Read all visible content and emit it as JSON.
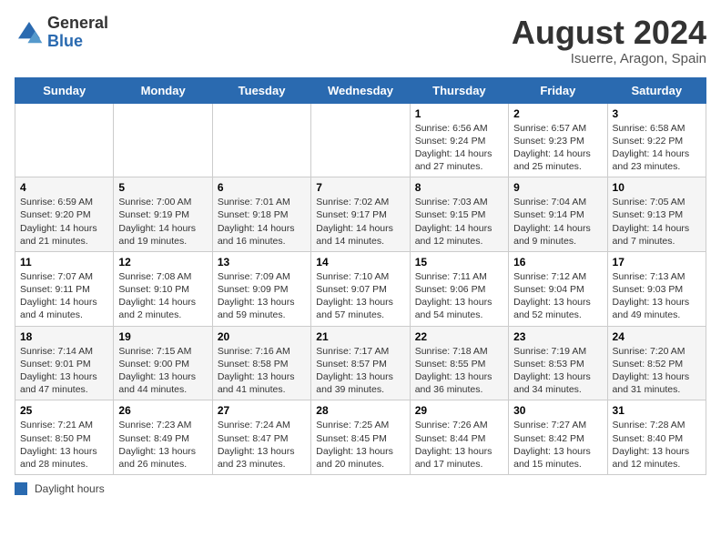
{
  "header": {
    "logo_general": "General",
    "logo_blue": "Blue",
    "month_year": "August 2024",
    "location": "Isuerre, Aragon, Spain"
  },
  "days_of_week": [
    "Sunday",
    "Monday",
    "Tuesday",
    "Wednesday",
    "Thursday",
    "Friday",
    "Saturday"
  ],
  "weeks": [
    [
      {
        "day": "",
        "info": ""
      },
      {
        "day": "",
        "info": ""
      },
      {
        "day": "",
        "info": ""
      },
      {
        "day": "",
        "info": ""
      },
      {
        "day": "1",
        "info": "Sunrise: 6:56 AM\nSunset: 9:24 PM\nDaylight: 14 hours and 27 minutes."
      },
      {
        "day": "2",
        "info": "Sunrise: 6:57 AM\nSunset: 9:23 PM\nDaylight: 14 hours and 25 minutes."
      },
      {
        "day": "3",
        "info": "Sunrise: 6:58 AM\nSunset: 9:22 PM\nDaylight: 14 hours and 23 minutes."
      }
    ],
    [
      {
        "day": "4",
        "info": "Sunrise: 6:59 AM\nSunset: 9:20 PM\nDaylight: 14 hours and 21 minutes."
      },
      {
        "day": "5",
        "info": "Sunrise: 7:00 AM\nSunset: 9:19 PM\nDaylight: 14 hours and 19 minutes."
      },
      {
        "day": "6",
        "info": "Sunrise: 7:01 AM\nSunset: 9:18 PM\nDaylight: 14 hours and 16 minutes."
      },
      {
        "day": "7",
        "info": "Sunrise: 7:02 AM\nSunset: 9:17 PM\nDaylight: 14 hours and 14 minutes."
      },
      {
        "day": "8",
        "info": "Sunrise: 7:03 AM\nSunset: 9:15 PM\nDaylight: 14 hours and 12 minutes."
      },
      {
        "day": "9",
        "info": "Sunrise: 7:04 AM\nSunset: 9:14 PM\nDaylight: 14 hours and 9 minutes."
      },
      {
        "day": "10",
        "info": "Sunrise: 7:05 AM\nSunset: 9:13 PM\nDaylight: 14 hours and 7 minutes."
      }
    ],
    [
      {
        "day": "11",
        "info": "Sunrise: 7:07 AM\nSunset: 9:11 PM\nDaylight: 14 hours and 4 minutes."
      },
      {
        "day": "12",
        "info": "Sunrise: 7:08 AM\nSunset: 9:10 PM\nDaylight: 14 hours and 2 minutes."
      },
      {
        "day": "13",
        "info": "Sunrise: 7:09 AM\nSunset: 9:09 PM\nDaylight: 13 hours and 59 minutes."
      },
      {
        "day": "14",
        "info": "Sunrise: 7:10 AM\nSunset: 9:07 PM\nDaylight: 13 hours and 57 minutes."
      },
      {
        "day": "15",
        "info": "Sunrise: 7:11 AM\nSunset: 9:06 PM\nDaylight: 13 hours and 54 minutes."
      },
      {
        "day": "16",
        "info": "Sunrise: 7:12 AM\nSunset: 9:04 PM\nDaylight: 13 hours and 52 minutes."
      },
      {
        "day": "17",
        "info": "Sunrise: 7:13 AM\nSunset: 9:03 PM\nDaylight: 13 hours and 49 minutes."
      }
    ],
    [
      {
        "day": "18",
        "info": "Sunrise: 7:14 AM\nSunset: 9:01 PM\nDaylight: 13 hours and 47 minutes."
      },
      {
        "day": "19",
        "info": "Sunrise: 7:15 AM\nSunset: 9:00 PM\nDaylight: 13 hours and 44 minutes."
      },
      {
        "day": "20",
        "info": "Sunrise: 7:16 AM\nSunset: 8:58 PM\nDaylight: 13 hours and 41 minutes."
      },
      {
        "day": "21",
        "info": "Sunrise: 7:17 AM\nSunset: 8:57 PM\nDaylight: 13 hours and 39 minutes."
      },
      {
        "day": "22",
        "info": "Sunrise: 7:18 AM\nSunset: 8:55 PM\nDaylight: 13 hours and 36 minutes."
      },
      {
        "day": "23",
        "info": "Sunrise: 7:19 AM\nSunset: 8:53 PM\nDaylight: 13 hours and 34 minutes."
      },
      {
        "day": "24",
        "info": "Sunrise: 7:20 AM\nSunset: 8:52 PM\nDaylight: 13 hours and 31 minutes."
      }
    ],
    [
      {
        "day": "25",
        "info": "Sunrise: 7:21 AM\nSunset: 8:50 PM\nDaylight: 13 hours and 28 minutes."
      },
      {
        "day": "26",
        "info": "Sunrise: 7:23 AM\nSunset: 8:49 PM\nDaylight: 13 hours and 26 minutes."
      },
      {
        "day": "27",
        "info": "Sunrise: 7:24 AM\nSunset: 8:47 PM\nDaylight: 13 hours and 23 minutes."
      },
      {
        "day": "28",
        "info": "Sunrise: 7:25 AM\nSunset: 8:45 PM\nDaylight: 13 hours and 20 minutes."
      },
      {
        "day": "29",
        "info": "Sunrise: 7:26 AM\nSunset: 8:44 PM\nDaylight: 13 hours and 17 minutes."
      },
      {
        "day": "30",
        "info": "Sunrise: 7:27 AM\nSunset: 8:42 PM\nDaylight: 13 hours and 15 minutes."
      },
      {
        "day": "31",
        "info": "Sunrise: 7:28 AM\nSunset: 8:40 PM\nDaylight: 13 hours and 12 minutes."
      }
    ]
  ],
  "legend": {
    "label": "Daylight hours"
  }
}
